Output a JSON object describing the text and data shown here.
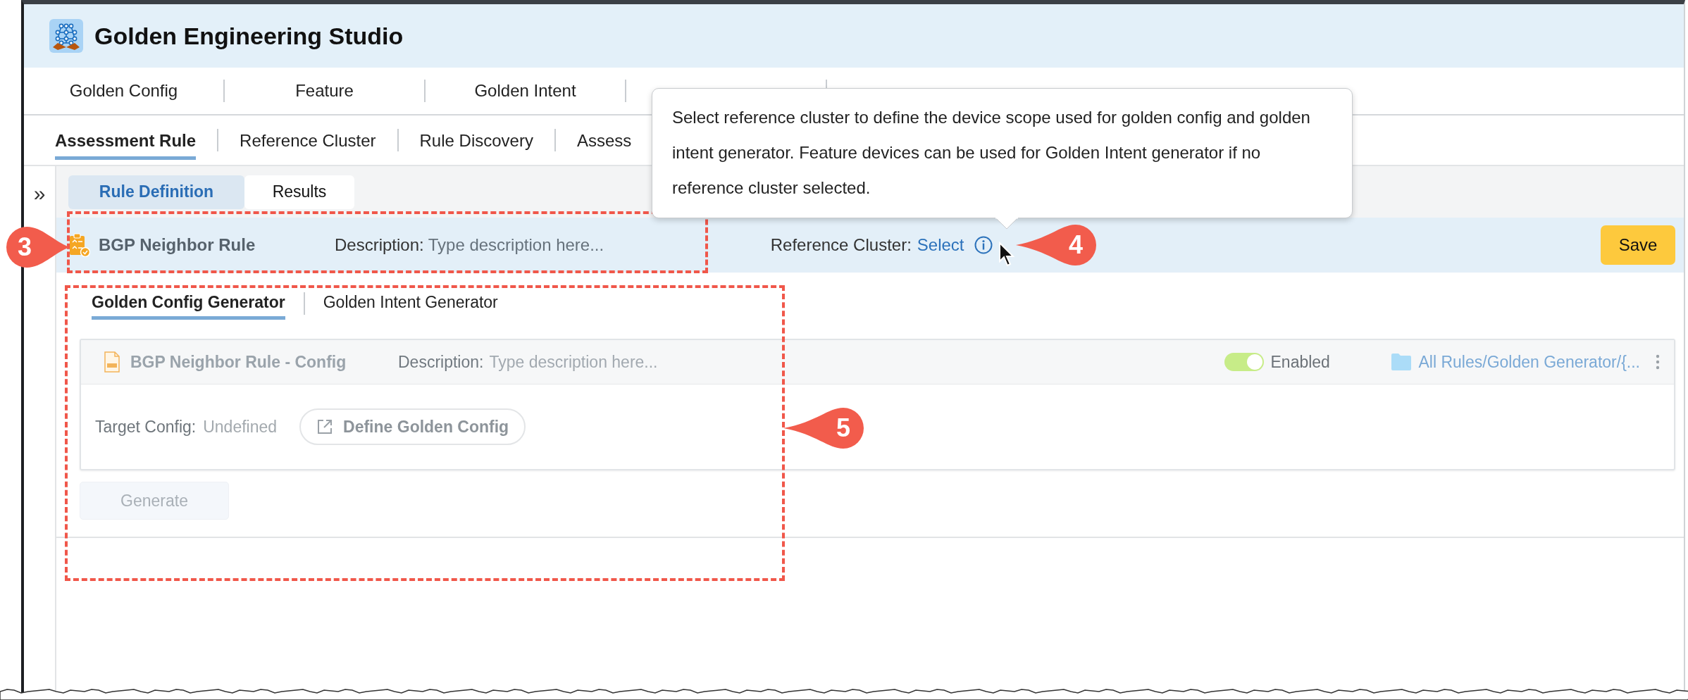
{
  "app": {
    "title": "Golden Engineering Studio"
  },
  "main_tabs": [
    {
      "label": "Golden Config",
      "selected": false
    },
    {
      "label": "Feature",
      "selected": false
    },
    {
      "label": "Golden Intent",
      "selected": false
    }
  ],
  "sub_tabs": [
    {
      "label": "Assessment Rule",
      "selected": true
    },
    {
      "label": "Reference Cluster",
      "selected": false
    },
    {
      "label": "Rule Discovery",
      "selected": false
    },
    {
      "label": "Assess",
      "selected": false
    }
  ],
  "sidebar_toggle": "»",
  "view_tabs": [
    {
      "label": "Rule Definition",
      "selected": true
    },
    {
      "label": "Results",
      "selected": false
    }
  ],
  "rule": {
    "name": "BGP Neighbor Rule",
    "description_label": "Description:",
    "description_placeholder": "Type description here...",
    "reference_label": "Reference Cluster:",
    "reference_link": "Select"
  },
  "save_button": "Save",
  "tooltip": {
    "text": "Select reference cluster to define the device scope used for golden config and golden intent generator. Feature devices can be used for Golden Intent generator if no reference cluster selected."
  },
  "generator_tabs": [
    {
      "label": "Golden Config Generator",
      "selected": true
    },
    {
      "label": "Golden Intent Generator",
      "selected": false
    }
  ],
  "config_card": {
    "name": "BGP Neighbor Rule - Config",
    "description_label": "Description:",
    "description_placeholder": "Type description here...",
    "enabled": true,
    "enabled_label": "Enabled",
    "path": "All Rules/Golden Generator/{...",
    "target_label": "Target Config:",
    "target_value": "Undefined",
    "define_button": "Define Golden Config"
  },
  "generate_button": {
    "label": "Generate",
    "disabled": true
  },
  "callouts": [
    {
      "number": "3"
    },
    {
      "number": "4"
    },
    {
      "number": "5"
    }
  ]
}
